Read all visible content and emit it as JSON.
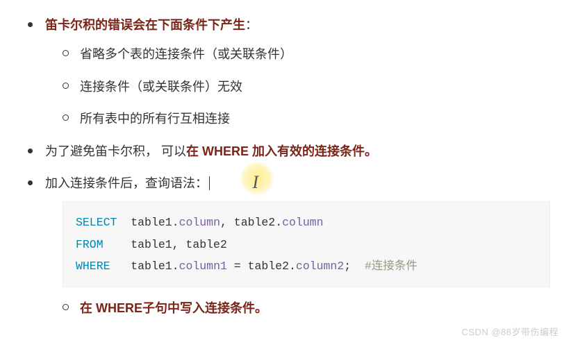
{
  "items": [
    {
      "prefix": "",
      "boldText": "笛卡尔积的错误会在下面条件下产生",
      "suffix": "：",
      "sub": [
        "省略多个表的连接条件（或关联条件）",
        "连接条件（或关联条件）无效",
        "所有表中的所有行互相连接"
      ]
    },
    {
      "prefix": "为了避免笛卡尔积， 可以",
      "boldText": "在 WHERE 加入有效的连接条件。",
      "suffix": ""
    },
    {
      "line3": "加入连接条件后，查询语法："
    }
  ],
  "code": {
    "kw1": "SELECT",
    "tbl1a": "table1",
    "col1a": "column",
    "comma": ", ",
    "tbl2a": "table2",
    "col2a": "column",
    "kw2": "FROM",
    "from_body": "table1, table2",
    "kw3": "WHERE",
    "tbl1b": "table1",
    "col1b": "column1",
    "eq": " = ",
    "tbl2b": "table2",
    "col2b": "column2",
    "semi": ";",
    "comment": "#连接条件"
  },
  "bottom": "在 WHERE子句中写入连接条件。",
  "watermark": "CSDN @88岁带伤编程"
}
